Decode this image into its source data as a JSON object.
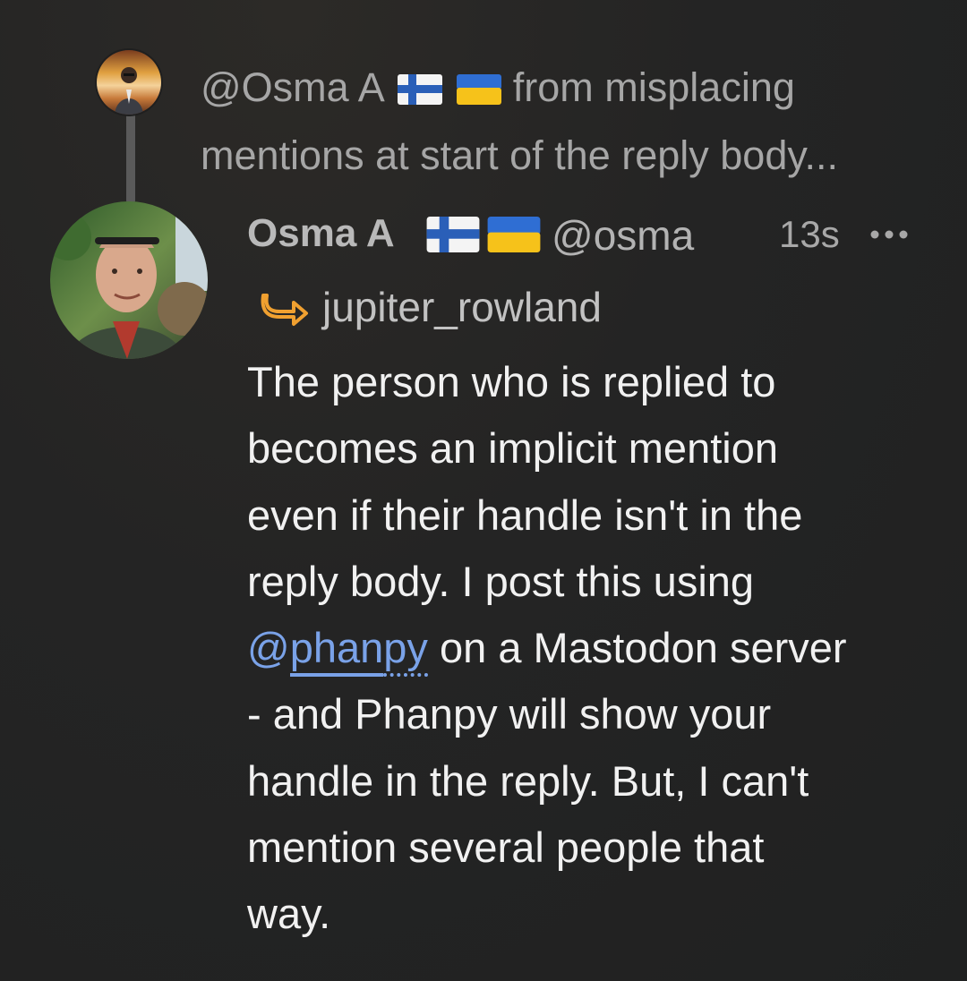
{
  "parent_post": {
    "mention": "@Osma A",
    "line1_rest": "from misplacing",
    "line2": "mentions at start of the reply body..."
  },
  "post": {
    "author_name": "Osma A",
    "author_handle": "@osma",
    "timestamp": "13s",
    "more_label": "•••",
    "reply_to_handle": "jupiter_rowland",
    "body": {
      "line1": "The person who is replied to",
      "line2": "becomes an implicit mention",
      "line3": "even if their handle isn't in the",
      "line4": "reply body. I post this using",
      "mention_at": "@",
      "mention_solid": "phan",
      "mention_dotted": "py",
      "line5_rest": " on a Mastodon server",
      "line6": "- and Phanpy will show your",
      "line7": "handle in the reply. But, I can't",
      "line8": "mention several people that",
      "line9": "way."
    }
  },
  "icons": {
    "flags": [
      "finland-flag-icon",
      "ukraine-flag-icon"
    ],
    "reply": "reply-arrow-icon",
    "more": "more-dots-icon"
  },
  "colors": {
    "background": "#232323",
    "mention": "#7aa2e8",
    "reply_icon": "#f0a030",
    "muted_text": "#a6a6a6"
  }
}
